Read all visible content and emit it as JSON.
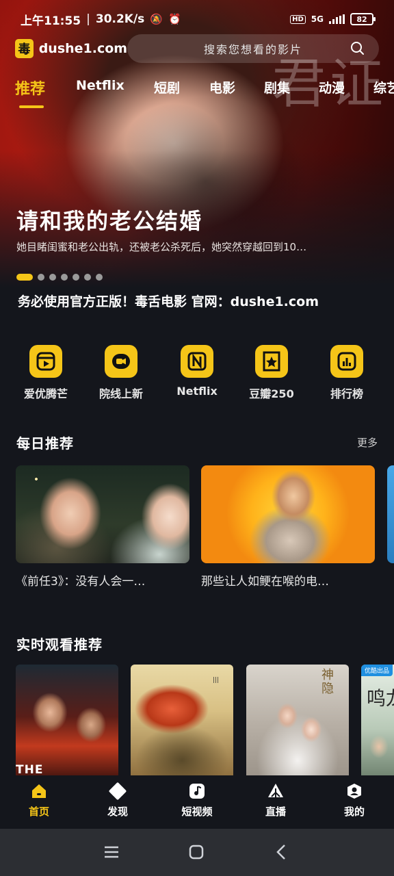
{
  "status_bar": {
    "time": "上午11:55",
    "separator": "|",
    "net_speed": "30.2K/s",
    "hd": "HD",
    "signal": "5G",
    "battery": "82"
  },
  "top_bar": {
    "logo_char": "毒",
    "site_name": "dushe1.com",
    "search_placeholder": "搜索您想看的影片"
  },
  "tabs": [
    {
      "label": "推荐",
      "active": true
    },
    {
      "label": "Netflix"
    },
    {
      "label": "短剧"
    },
    {
      "label": "电影"
    },
    {
      "label": "剧集"
    },
    {
      "label": "动漫"
    },
    {
      "label": "综艺"
    }
  ],
  "hero": {
    "deco_text": "君证",
    "title": "请和我的老公结婚",
    "description": "她目睹闺蜜和老公出轨，还被老公杀死后，她突然穿越回到10…",
    "slide_count": 7,
    "active_slide": 0
  },
  "notice": "务必使用官方正版！毒舌电影 官网：dushe1.com",
  "shortcuts": [
    {
      "label": "爱优腾芒",
      "icon": "play-icon"
    },
    {
      "label": "院线上新",
      "icon": "video-camera-icon"
    },
    {
      "label": "Netflix",
      "icon": "netflix-n-icon"
    },
    {
      "label": "豆瓣250",
      "icon": "star-badge-icon"
    },
    {
      "label": "排行榜",
      "icon": "bar-chart-icon"
    }
  ],
  "daily": {
    "title": "每日推荐",
    "more": "更多",
    "items": [
      {
        "caption": "《前任3》：没有人会一…"
      },
      {
        "caption": "那些让人如鲠在喉的电…"
      }
    ]
  },
  "realtime": {
    "title": "实时观看推荐",
    "poster1_text": "THE",
    "poster3_text": "神隐",
    "poster4_badge": "优酷出品",
    "poster4_text": "鸣龙"
  },
  "bottom_nav": [
    {
      "label": "首页",
      "icon": "home-icon",
      "active": true
    },
    {
      "label": "发现",
      "icon": "discover-icon"
    },
    {
      "label": "短视频",
      "icon": "music-note-icon"
    },
    {
      "label": "直播",
      "icon": "live-icon"
    },
    {
      "label": "我的",
      "icon": "profile-icon"
    }
  ],
  "colors": {
    "accent": "#f5c518",
    "background": "#14161c"
  }
}
